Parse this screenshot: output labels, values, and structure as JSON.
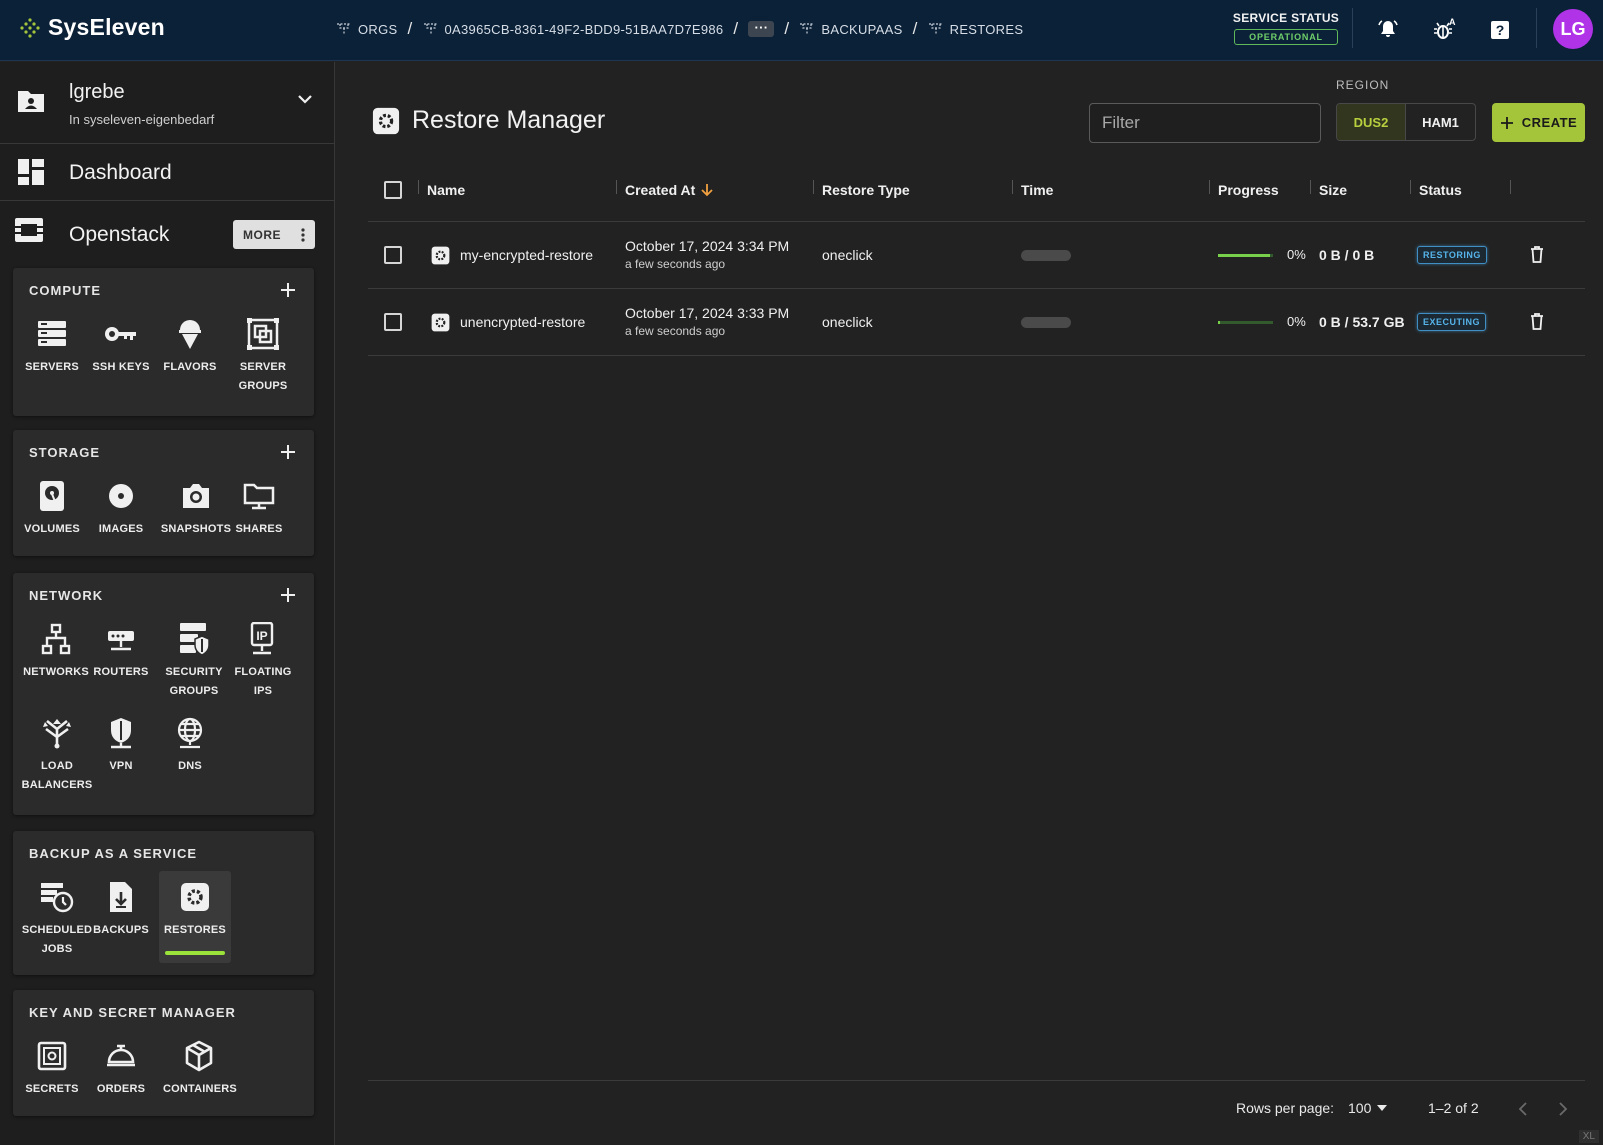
{
  "brand": {
    "name": "SysEleven"
  },
  "breadcrumbs": [
    "ORGS",
    "0A3965CB-8361-49F2-BDD9-51BAA7D7E986",
    "···",
    "BACKUPAAS",
    "RESTORES"
  ],
  "service_status": {
    "title": "SERVICE STATUS",
    "state": "OPERATIONAL"
  },
  "user": {
    "initials": "LG",
    "name": "lgrebe",
    "org": "In syseleven-eigenbedarf"
  },
  "nav": {
    "dashboard": "Dashboard",
    "openstack": "Openstack",
    "more": "MORE"
  },
  "compute": {
    "title": "COMPUTE",
    "items": [
      "SERVERS",
      "SSH KEYS",
      "FLAVORS",
      "SERVER GROUPS"
    ]
  },
  "storage": {
    "title": "STORAGE",
    "items": [
      "VOLUMES",
      "IMAGES",
      "SNAPSHOTS",
      "SHARES"
    ]
  },
  "network": {
    "title": "NETWORK",
    "items": [
      "NETWORKS",
      "ROUTERS",
      "SECURITY GROUPS",
      "FLOATING IPS",
      "LOAD BALANCERS",
      "VPN",
      "DNS"
    ]
  },
  "backup": {
    "title": "BACKUP AS A SERVICE",
    "items": [
      "SCHEDULED JOBS",
      "BACKUPS",
      "RESTORES"
    ]
  },
  "keymgr": {
    "title": "KEY AND SECRET MANAGER",
    "items": [
      "SECRETS",
      "ORDERS",
      "CONTAINERS"
    ]
  },
  "page": {
    "title": "Restore Manager",
    "filter_placeholder": "Filter",
    "region_label": "REGION",
    "regions": [
      "DUS2",
      "HAM1"
    ],
    "selected_region": "DUS2",
    "create_label": "CREATE"
  },
  "table": {
    "columns": [
      "Name",
      "Created At",
      "Restore Type",
      "Time",
      "Progress",
      "Size",
      "Status"
    ],
    "sort": {
      "column": "Created At",
      "direction": "descending"
    },
    "rows": [
      {
        "name": "my-encrypted-restore",
        "created": "October 17, 2024 3:34 PM",
        "relative": "a few seconds ago",
        "type": "oneclick",
        "progress": "0%",
        "progress_fill": 0.95,
        "size": "0 B / 0 B",
        "status": "RESTORING"
      },
      {
        "name": "unencrypted-restore",
        "created": "October 17, 2024 3:33 PM",
        "relative": "a few seconds ago",
        "type": "oneclick",
        "progress": "0%",
        "progress_fill": 0.0,
        "size": "0 B / 53.7 GB",
        "status": "EXECUTING"
      }
    ]
  },
  "pagination": {
    "rows_label": "Rows per page:",
    "rows_value": "100",
    "range": "1–2 of 2"
  },
  "corner_mark": "XL",
  "colors": {
    "topbar": "#0b2138",
    "accent": "#a4c43a",
    "active": "#9be23b",
    "status_ok": "#6fcf69",
    "status_info": "#56b4ea",
    "avatar": "#b033e8"
  }
}
